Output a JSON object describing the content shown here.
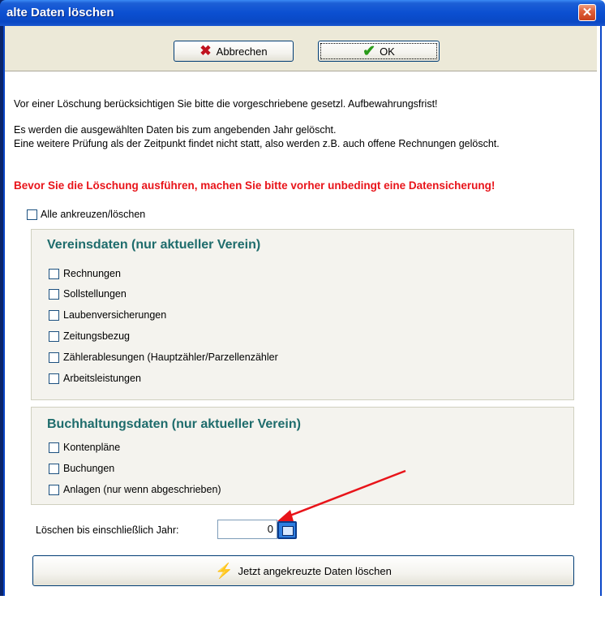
{
  "window": {
    "title": "alte Daten löschen",
    "close_label": "✕"
  },
  "toolbar": {
    "cancel_label": "Abbrechen",
    "ok_label": "OK"
  },
  "info": {
    "line1": "Vor einer Löschung berücksichtigen Sie bitte die vorgeschriebene gesetzl. Aufbewahrungsfrist!",
    "line2": "Es werden die ausgewählten Daten bis zum angebenden Jahr gelöscht.",
    "line3": "Eine weitere Prüfung als der Zeitpunkt findet nicht statt, also werden z.B. auch offene Rechnungen gelöscht.",
    "warning": "Bevor Sie die Löschung ausführen, machen Sie bitte vorher unbedingt eine Datensicherung!"
  },
  "select_all_label": "Alle ankreuzen/löschen",
  "vereinsdaten": {
    "title": "Vereinsdaten (nur aktueller Verein)",
    "items": [
      "Rechnungen",
      "Sollstellungen",
      "Laubenversicherungen",
      "Zeitungsbezug",
      "Zählerablesungen (Hauptzähler/Parzellenzähler",
      "Arbeitsleistungen"
    ]
  },
  "buchhaltung": {
    "title": "Buchhaltungsdaten  (nur aktueller Verein)",
    "items": [
      "Kontenpläne",
      "Buchungen",
      "Anlagen (nur wenn abgeschrieben)"
    ]
  },
  "year": {
    "label": "Löschen bis einschließlich Jahr:",
    "value": "0"
  },
  "delete_button_label": "Jetzt angekreuzte Daten  löschen",
  "colors": {
    "title_bar": "#0b4fd1",
    "warning": "#e8141a",
    "group_title": "#1e6c6c",
    "arrow": "#e8141a"
  }
}
